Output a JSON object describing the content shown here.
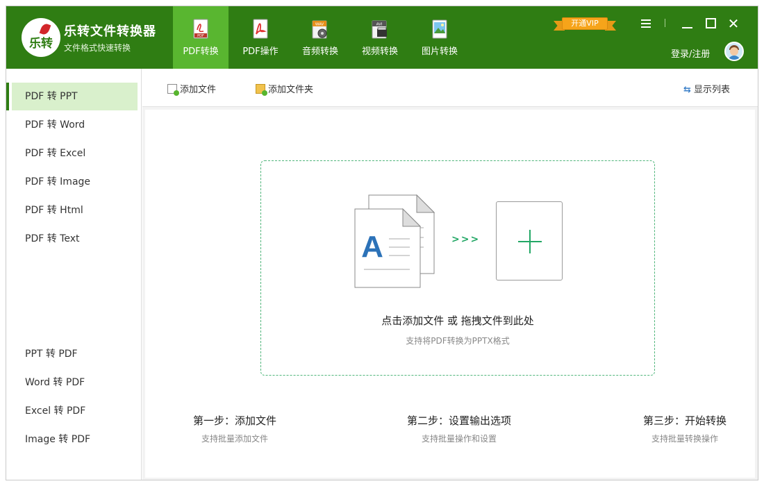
{
  "app": {
    "logo_text": "乐转",
    "title": "乐转文件转换器",
    "subtitle": "文件格式快速转换"
  },
  "nav": {
    "tabs": [
      {
        "label": "PDF转换",
        "icon": "pdf-convert-icon",
        "active": true
      },
      {
        "label": "PDF操作",
        "icon": "pdf-operate-icon",
        "active": false
      },
      {
        "label": "音频转换",
        "icon": "audio-wav-icon",
        "active": false
      },
      {
        "label": "视频转换",
        "icon": "video-avi-icon",
        "active": false
      },
      {
        "label": "图片转换",
        "icon": "image-icon",
        "active": false
      }
    ],
    "pdf_badge": "PDF",
    "wav_badge": "WAV",
    "avi_badge": "AVI"
  },
  "header": {
    "vip_label": "开通VIP",
    "login_label": "登录/注册"
  },
  "sidebar": {
    "items": [
      {
        "label": "PDF 转 PPT",
        "active": true
      },
      {
        "label": "PDF 转 Word",
        "active": false
      },
      {
        "label": "PDF 转 Excel",
        "active": false
      },
      {
        "label": "PDF 转 Image",
        "active": false
      },
      {
        "label": "PDF 转 Html",
        "active": false
      },
      {
        "label": "PDF 转 Text",
        "active": false
      }
    ],
    "bottom_items": [
      {
        "label": "PPT 转 PDF",
        "active": false
      },
      {
        "label": "Word 转 PDF",
        "active": false
      },
      {
        "label": "Excel 转 PDF",
        "active": false
      },
      {
        "label": "Image 转 PDF",
        "active": false
      }
    ]
  },
  "toolbar": {
    "add_file": "添加文件",
    "add_folder": "添加文件夹",
    "show_list": "显示列表"
  },
  "dropzone": {
    "doc_letter": "A",
    "arrows": ">>>",
    "main_text": "点击添加文件 或 拖拽文件到此处",
    "sub_text": "支持将PDF转换为PPTX格式"
  },
  "steps": [
    {
      "title": "第一步：添加文件",
      "desc": "支持批量添加文件"
    },
    {
      "title": "第二步：设置输出选项",
      "desc": "支持批量操作和设置"
    },
    {
      "title": "第三步：开始转换",
      "desc": "支持批量转换操作"
    }
  ],
  "colors": {
    "header_bg": "#2f7d13",
    "active_tab": "#59b630",
    "active_side": "#d9f0cc",
    "accent_green": "#22a765",
    "vip_orange": "#f6a41a"
  }
}
